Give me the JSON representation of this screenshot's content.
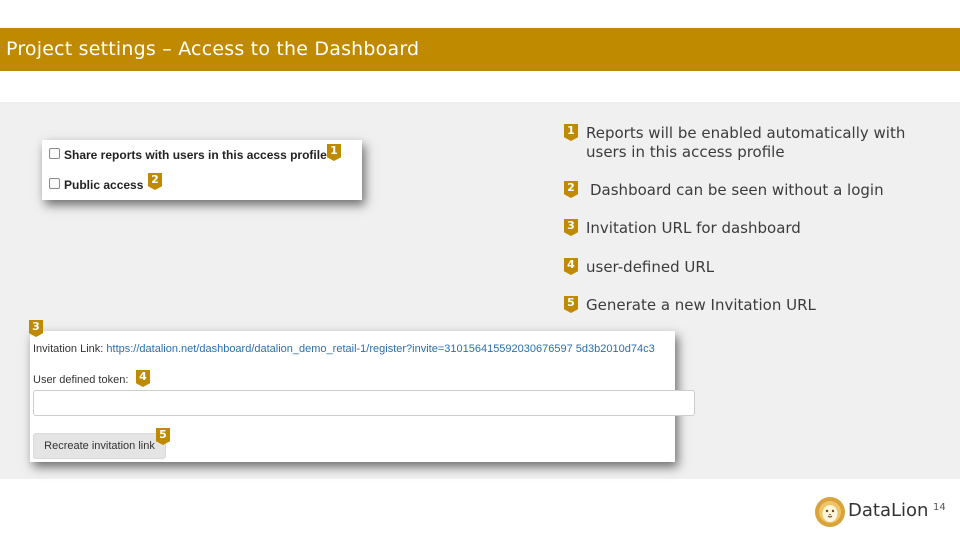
{
  "header": {
    "title": "Project settings – Access to the Dashboard"
  },
  "colors": {
    "accent": "#c08a00",
    "band": "#f0f0f0",
    "link": "#2a6fb0"
  },
  "sharing_panel": {
    "share_reports_label": "Share reports with users in this access profile",
    "share_reports_checked": false,
    "public_access_label": "Public access",
    "public_access_checked": false
  },
  "markers": [
    "1",
    "2",
    "3",
    "4",
    "5"
  ],
  "legend": [
    {
      "number": "1",
      "text": "Reports will be enabled automatically with users in this access profile"
    },
    {
      "number": "2",
      "text": "Dashboard can be seen without a login"
    },
    {
      "number": "3",
      "text": "Invitation URL for dashboard"
    },
    {
      "number": "4",
      "text": "user-defined URL"
    },
    {
      "number": "5",
      "text": "Generate a new Invitation URL"
    }
  ],
  "invitation_panel": {
    "link_label": "Invitation Link:",
    "link_url": "https://datalion.net/dashboard/datalion_demo_retail-1/register?invite=310156415592030676597 5d3b2010d74c3",
    "token_label": "User defined token:",
    "token_value": "",
    "recreate_button_label": "Recreate invitation link"
  },
  "logo": {
    "name": "DataLion",
    "icon": "lion-head-icon"
  },
  "page_number": "14"
}
